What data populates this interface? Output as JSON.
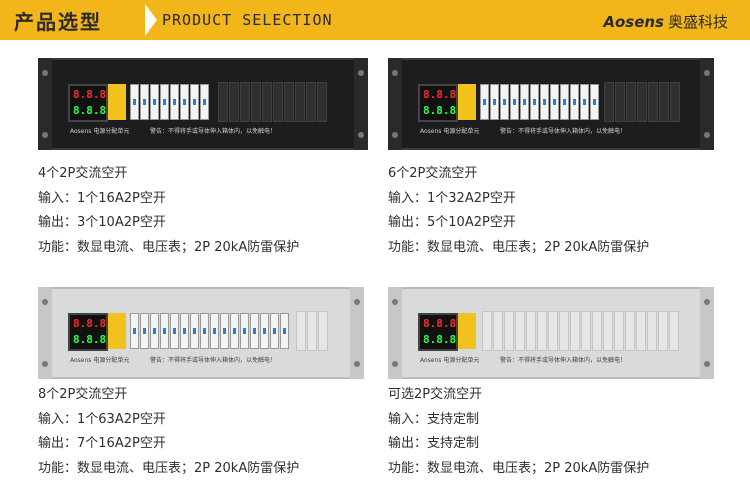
{
  "header": {
    "title_cn": "产品选型",
    "title_en": "PRODUCT SELECTION",
    "brand_en": "Aosens",
    "brand_cn": "奥盛科技"
  },
  "panel_texts": {
    "brand": "Aosens",
    "unit_name": "电源分配单元",
    "warning": "警告：不得将手或导体伸入箱体内，以免触电！",
    "meter_top": "8.8.8",
    "meter_bottom": "8.8.8"
  },
  "products": [
    {
      "title": "4个2P交流空开",
      "input": "输入：1个16A2P空开",
      "output": "输出：3个10A2P空开",
      "function": "功能：数显电流、电压表；2P 20kA防雷保护"
    },
    {
      "title": "6个2P交流空开",
      "input": "输入：1个32A2P空开",
      "output": "输出：5个10A2P空开",
      "function": "功能：数显电流、电压表；2P 20kA防雷保护"
    },
    {
      "title": "8个2P交流空开",
      "input": "输入：1个63A2P空开",
      "output": "输出：7个16A2P空开",
      "function": "功能：数显电流、电压表；2P 20kA防雷保护"
    },
    {
      "title": "可选2P交流空开",
      "input": "输入：支持定制",
      "output": "输出：支持定制",
      "function": "功能：数显电流、电压表；2P 20kA防雷保护"
    }
  ]
}
